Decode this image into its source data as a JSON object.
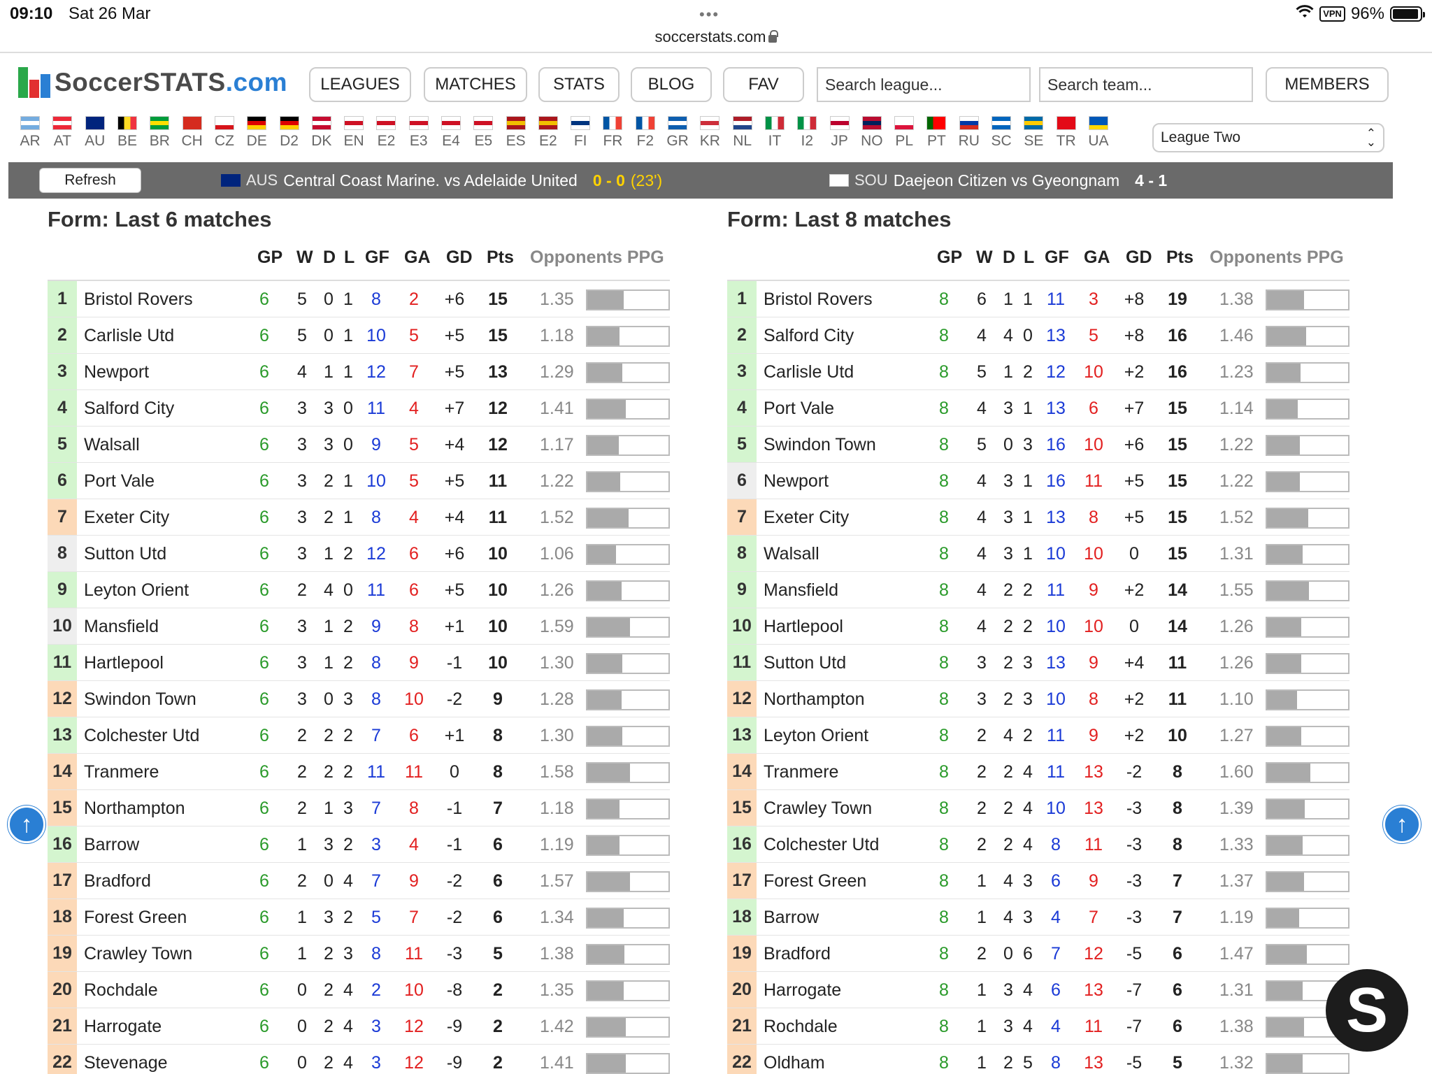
{
  "status": {
    "time": "09:10",
    "date": "Sat 26 Mar",
    "dots": "•••",
    "url": "soccerstats.com",
    "vpn": "VPN",
    "battery": "96%"
  },
  "logo": {
    "main": "SoccerSTATS",
    "suffix": ".com"
  },
  "nav": {
    "leagues": "LEAGUES",
    "matches": "MATCHES",
    "stats": "STATS",
    "blog": "BLOG",
    "fav": "FAV",
    "members": "MEMBERS",
    "search_league": "Search league...",
    "search_team": "Search team..."
  },
  "flags": [
    {
      "code": "AR",
      "colors": [
        "#74acdf",
        "#ffffff",
        "#74acdf"
      ]
    },
    {
      "code": "AT",
      "colors": [
        "#ed2939",
        "#ffffff",
        "#ed2939"
      ]
    },
    {
      "code": "AU",
      "colors": [
        "#00247d",
        "#00247d",
        "#00247d"
      ]
    },
    {
      "code": "BE",
      "colors": [
        "#000000",
        "#fdda24",
        "#ef3340"
      ],
      "vertical": true
    },
    {
      "code": "BR",
      "colors": [
        "#009c3b",
        "#ffdf00",
        "#009c3b"
      ]
    },
    {
      "code": "CH",
      "colors": [
        "#d52b1e",
        "#d52b1e",
        "#d52b1e"
      ]
    },
    {
      "code": "CZ",
      "colors": [
        "#ffffff",
        "#ffffff",
        "#d7141a"
      ]
    },
    {
      "code": "DE",
      "colors": [
        "#000000",
        "#dd0000",
        "#ffce00"
      ]
    },
    {
      "code": "D2",
      "colors": [
        "#000000",
        "#dd0000",
        "#ffce00"
      ]
    },
    {
      "code": "DK",
      "colors": [
        "#c60c30",
        "#ffffff",
        "#c60c30"
      ]
    },
    {
      "code": "EN",
      "colors": [
        "#ffffff",
        "#ce1124",
        "#ffffff"
      ]
    },
    {
      "code": "E2",
      "colors": [
        "#ffffff",
        "#ce1124",
        "#ffffff"
      ]
    },
    {
      "code": "E3",
      "colors": [
        "#ffffff",
        "#ce1124",
        "#ffffff"
      ]
    },
    {
      "code": "E4",
      "colors": [
        "#ffffff",
        "#ce1124",
        "#ffffff"
      ]
    },
    {
      "code": "E5",
      "colors": [
        "#ffffff",
        "#ce1124",
        "#ffffff"
      ]
    },
    {
      "code": "ES",
      "colors": [
        "#aa151b",
        "#f1bf00",
        "#aa151b"
      ]
    },
    {
      "code": "E2",
      "colors": [
        "#aa151b",
        "#f1bf00",
        "#aa151b"
      ]
    },
    {
      "code": "FI",
      "colors": [
        "#ffffff",
        "#003580",
        "#ffffff"
      ]
    },
    {
      "code": "FR",
      "colors": [
        "#0055a4",
        "#ffffff",
        "#ef4135"
      ],
      "vertical": true
    },
    {
      "code": "F2",
      "colors": [
        "#0055a4",
        "#ffffff",
        "#ef4135"
      ],
      "vertical": true
    },
    {
      "code": "GR",
      "colors": [
        "#0d5eaf",
        "#ffffff",
        "#0d5eaf"
      ]
    },
    {
      "code": "KR",
      "colors": [
        "#ffffff",
        "#cd2e3a",
        "#ffffff"
      ]
    },
    {
      "code": "NL",
      "colors": [
        "#ae1c28",
        "#ffffff",
        "#21468b"
      ]
    },
    {
      "code": "IT",
      "colors": [
        "#009246",
        "#ffffff",
        "#ce2b37"
      ],
      "vertical": true
    },
    {
      "code": "I2",
      "colors": [
        "#009246",
        "#ffffff",
        "#ce2b37"
      ],
      "vertical": true
    },
    {
      "code": "JP",
      "colors": [
        "#ffffff",
        "#bc002d",
        "#ffffff"
      ]
    },
    {
      "code": "NO",
      "colors": [
        "#ba0c2f",
        "#00205b",
        "#ba0c2f"
      ]
    },
    {
      "code": "PL",
      "colors": [
        "#ffffff",
        "#ffffff",
        "#dc143c"
      ]
    },
    {
      "code": "PT",
      "colors": [
        "#006600",
        "#ff0000",
        "#ff0000"
      ],
      "vertical": true
    },
    {
      "code": "RU",
      "colors": [
        "#ffffff",
        "#0039a6",
        "#d52b1e"
      ]
    },
    {
      "code": "SC",
      "colors": [
        "#0065bd",
        "#ffffff",
        "#0065bd"
      ]
    },
    {
      "code": "SE",
      "colors": [
        "#006aa7",
        "#fecc00",
        "#006aa7"
      ]
    },
    {
      "code": "TR",
      "colors": [
        "#e30a17",
        "#e30a17",
        "#e30a17"
      ]
    },
    {
      "code": "UA",
      "colors": [
        "#0057b7",
        "#0057b7",
        "#ffd700"
      ]
    }
  ],
  "league_select": "League Two",
  "ticker": {
    "refresh": "Refresh",
    "m1": {
      "cc": "AUS",
      "teams": "Central Coast Marine. vs Adelaide United",
      "score": "0 - 0",
      "minute": "(23')"
    },
    "m2": {
      "cc": "SOU",
      "teams": "Daejeon Citizen vs Gyeongnam",
      "score": "4 - 1"
    }
  },
  "colors": {
    "zone_green": "#d4f5cf",
    "zone_orange": "#fcd9b8",
    "zone_grey": "#eeeeee",
    "accent": "#2a7fd4"
  },
  "left": {
    "title": "Form: Last 6 matches",
    "headers": {
      "gp": "GP",
      "w": "W",
      "d": "D",
      "l": "L",
      "gf": "GF",
      "ga": "GA",
      "gd": "GD",
      "pts": "Pts",
      "ppg": "Opponents PPG"
    },
    "rows": [
      {
        "pos": "1",
        "team": "Bristol Rovers",
        "gp": "6",
        "w": "5",
        "d": "0",
        "l": "1",
        "gf": "8",
        "ga": "2",
        "gd": "+6",
        "pts": "15",
        "ppg": "1.35",
        "zone": "green"
      },
      {
        "pos": "2",
        "team": "Carlisle Utd",
        "gp": "6",
        "w": "5",
        "d": "0",
        "l": "1",
        "gf": "10",
        "ga": "5",
        "gd": "+5",
        "pts": "15",
        "ppg": "1.18",
        "zone": "green"
      },
      {
        "pos": "3",
        "team": "Newport",
        "gp": "6",
        "w": "4",
        "d": "1",
        "l": "1",
        "gf": "12",
        "ga": "7",
        "gd": "+5",
        "pts": "13",
        "ppg": "1.29",
        "zone": "green"
      },
      {
        "pos": "4",
        "team": "Salford City",
        "gp": "6",
        "w": "3",
        "d": "3",
        "l": "0",
        "gf": "11",
        "ga": "4",
        "gd": "+7",
        "pts": "12",
        "ppg": "1.41",
        "zone": "green"
      },
      {
        "pos": "5",
        "team": "Walsall",
        "gp": "6",
        "w": "3",
        "d": "3",
        "l": "0",
        "gf": "9",
        "ga": "5",
        "gd": "+4",
        "pts": "12",
        "ppg": "1.17",
        "zone": "green"
      },
      {
        "pos": "6",
        "team": "Port Vale",
        "gp": "6",
        "w": "3",
        "d": "2",
        "l": "1",
        "gf": "10",
        "ga": "5",
        "gd": "+5",
        "pts": "11",
        "ppg": "1.22",
        "zone": "green"
      },
      {
        "pos": "7",
        "team": "Exeter City",
        "gp": "6",
        "w": "3",
        "d": "2",
        "l": "1",
        "gf": "8",
        "ga": "4",
        "gd": "+4",
        "pts": "11",
        "ppg": "1.52",
        "zone": "orange"
      },
      {
        "pos": "8",
        "team": "Sutton Utd",
        "gp": "6",
        "w": "3",
        "d": "1",
        "l": "2",
        "gf": "12",
        "ga": "6",
        "gd": "+6",
        "pts": "10",
        "ppg": "1.06",
        "zone": "grey"
      },
      {
        "pos": "9",
        "team": "Leyton Orient",
        "gp": "6",
        "w": "2",
        "d": "4",
        "l": "0",
        "gf": "11",
        "ga": "6",
        "gd": "+5",
        "pts": "10",
        "ppg": "1.26",
        "zone": "green"
      },
      {
        "pos": "10",
        "team": "Mansfield",
        "gp": "6",
        "w": "3",
        "d": "1",
        "l": "2",
        "gf": "9",
        "ga": "8",
        "gd": "+1",
        "pts": "10",
        "ppg": "1.59",
        "zone": "grey"
      },
      {
        "pos": "11",
        "team": "Hartlepool",
        "gp": "6",
        "w": "3",
        "d": "1",
        "l": "2",
        "gf": "8",
        "ga": "9",
        "gd": "-1",
        "pts": "10",
        "ppg": "1.30",
        "zone": "green"
      },
      {
        "pos": "12",
        "team": "Swindon Town",
        "gp": "6",
        "w": "3",
        "d": "0",
        "l": "3",
        "gf": "8",
        "ga": "10",
        "gd": "-2",
        "pts": "9",
        "ppg": "1.28",
        "zone": "orange"
      },
      {
        "pos": "13",
        "team": "Colchester Utd",
        "gp": "6",
        "w": "2",
        "d": "2",
        "l": "2",
        "gf": "7",
        "ga": "6",
        "gd": "+1",
        "pts": "8",
        "ppg": "1.30",
        "zone": "green"
      },
      {
        "pos": "14",
        "team": "Tranmere",
        "gp": "6",
        "w": "2",
        "d": "2",
        "l": "2",
        "gf": "11",
        "ga": "11",
        "gd": "0",
        "pts": "8",
        "ppg": "1.58",
        "zone": "orange"
      },
      {
        "pos": "15",
        "team": "Northampton",
        "gp": "6",
        "w": "2",
        "d": "1",
        "l": "3",
        "gf": "7",
        "ga": "8",
        "gd": "-1",
        "pts": "7",
        "ppg": "1.18",
        "zone": "orange"
      },
      {
        "pos": "16",
        "team": "Barrow",
        "gp": "6",
        "w": "1",
        "d": "3",
        "l": "2",
        "gf": "3",
        "ga": "4",
        "gd": "-1",
        "pts": "6",
        "ppg": "1.19",
        "zone": "green"
      },
      {
        "pos": "17",
        "team": "Bradford",
        "gp": "6",
        "w": "2",
        "d": "0",
        "l": "4",
        "gf": "7",
        "ga": "9",
        "gd": "-2",
        "pts": "6",
        "ppg": "1.57",
        "zone": "orange"
      },
      {
        "pos": "18",
        "team": "Forest Green",
        "gp": "6",
        "w": "1",
        "d": "3",
        "l": "2",
        "gf": "5",
        "ga": "7",
        "gd": "-2",
        "pts": "6",
        "ppg": "1.34",
        "zone": "orange"
      },
      {
        "pos": "19",
        "team": "Crawley Town",
        "gp": "6",
        "w": "1",
        "d": "2",
        "l": "3",
        "gf": "8",
        "ga": "11",
        "gd": "-3",
        "pts": "5",
        "ppg": "1.38",
        "zone": "orange"
      },
      {
        "pos": "20",
        "team": "Rochdale",
        "gp": "6",
        "w": "0",
        "d": "2",
        "l": "4",
        "gf": "2",
        "ga": "10",
        "gd": "-8",
        "pts": "2",
        "ppg": "1.35",
        "zone": "orange"
      },
      {
        "pos": "21",
        "team": "Harrogate",
        "gp": "6",
        "w": "0",
        "d": "2",
        "l": "4",
        "gf": "3",
        "ga": "12",
        "gd": "-9",
        "pts": "2",
        "ppg": "1.42",
        "zone": "orange"
      },
      {
        "pos": "22",
        "team": "Stevenage",
        "gp": "6",
        "w": "0",
        "d": "2",
        "l": "4",
        "gf": "3",
        "ga": "12",
        "gd": "-9",
        "pts": "2",
        "ppg": "1.41",
        "zone": "orange"
      }
    ]
  },
  "right": {
    "title": "Form: Last 8 matches",
    "headers": {
      "gp": "GP",
      "w": "W",
      "d": "D",
      "l": "L",
      "gf": "GF",
      "ga": "GA",
      "gd": "GD",
      "pts": "Pts",
      "ppg": "Opponents PPG"
    },
    "rows": [
      {
        "pos": "1",
        "team": "Bristol Rovers",
        "gp": "8",
        "w": "6",
        "d": "1",
        "l": "1",
        "gf": "11",
        "ga": "3",
        "gd": "+8",
        "pts": "19",
        "ppg": "1.38",
        "zone": "green"
      },
      {
        "pos": "2",
        "team": "Salford City",
        "gp": "8",
        "w": "4",
        "d": "4",
        "l": "0",
        "gf": "13",
        "ga": "5",
        "gd": "+8",
        "pts": "16",
        "ppg": "1.46",
        "zone": "green"
      },
      {
        "pos": "3",
        "team": "Carlisle Utd",
        "gp": "8",
        "w": "5",
        "d": "1",
        "l": "2",
        "gf": "12",
        "ga": "10",
        "gd": "+2",
        "pts": "16",
        "ppg": "1.23",
        "zone": "green"
      },
      {
        "pos": "4",
        "team": "Port Vale",
        "gp": "8",
        "w": "4",
        "d": "3",
        "l": "1",
        "gf": "13",
        "ga": "6",
        "gd": "+7",
        "pts": "15",
        "ppg": "1.14",
        "zone": "green"
      },
      {
        "pos": "5",
        "team": "Swindon Town",
        "gp": "8",
        "w": "5",
        "d": "0",
        "l": "3",
        "gf": "16",
        "ga": "10",
        "gd": "+6",
        "pts": "15",
        "ppg": "1.22",
        "zone": "green"
      },
      {
        "pos": "6",
        "team": "Newport",
        "gp": "8",
        "w": "4",
        "d": "3",
        "l": "1",
        "gf": "16",
        "ga": "11",
        "gd": "+5",
        "pts": "15",
        "ppg": "1.22",
        "zone": "grey"
      },
      {
        "pos": "7",
        "team": "Exeter City",
        "gp": "8",
        "w": "4",
        "d": "3",
        "l": "1",
        "gf": "13",
        "ga": "8",
        "gd": "+5",
        "pts": "15",
        "ppg": "1.52",
        "zone": "orange"
      },
      {
        "pos": "8",
        "team": "Walsall",
        "gp": "8",
        "w": "4",
        "d": "3",
        "l": "1",
        "gf": "10",
        "ga": "10",
        "gd": "0",
        "pts": "15",
        "ppg": "1.31",
        "zone": "green"
      },
      {
        "pos": "9",
        "team": "Mansfield",
        "gp": "8",
        "w": "4",
        "d": "2",
        "l": "2",
        "gf": "11",
        "ga": "9",
        "gd": "+2",
        "pts": "14",
        "ppg": "1.55",
        "zone": "green"
      },
      {
        "pos": "10",
        "team": "Hartlepool",
        "gp": "8",
        "w": "4",
        "d": "2",
        "l": "2",
        "gf": "10",
        "ga": "10",
        "gd": "0",
        "pts": "14",
        "ppg": "1.26",
        "zone": "green"
      },
      {
        "pos": "11",
        "team": "Sutton Utd",
        "gp": "8",
        "w": "3",
        "d": "2",
        "l": "3",
        "gf": "13",
        "ga": "9",
        "gd": "+4",
        "pts": "11",
        "ppg": "1.26",
        "zone": "green"
      },
      {
        "pos": "12",
        "team": "Northampton",
        "gp": "8",
        "w": "3",
        "d": "2",
        "l": "3",
        "gf": "10",
        "ga": "8",
        "gd": "+2",
        "pts": "11",
        "ppg": "1.10",
        "zone": "orange"
      },
      {
        "pos": "13",
        "team": "Leyton Orient",
        "gp": "8",
        "w": "2",
        "d": "4",
        "l": "2",
        "gf": "11",
        "ga": "9",
        "gd": "+2",
        "pts": "10",
        "ppg": "1.27",
        "zone": "green"
      },
      {
        "pos": "14",
        "team": "Tranmere",
        "gp": "8",
        "w": "2",
        "d": "2",
        "l": "4",
        "gf": "11",
        "ga": "13",
        "gd": "-2",
        "pts": "8",
        "ppg": "1.60",
        "zone": "orange"
      },
      {
        "pos": "15",
        "team": "Crawley Town",
        "gp": "8",
        "w": "2",
        "d": "2",
        "l": "4",
        "gf": "10",
        "ga": "13",
        "gd": "-3",
        "pts": "8",
        "ppg": "1.39",
        "zone": "orange"
      },
      {
        "pos": "16",
        "team": "Colchester Utd",
        "gp": "8",
        "w": "2",
        "d": "2",
        "l": "4",
        "gf": "8",
        "ga": "11",
        "gd": "-3",
        "pts": "8",
        "ppg": "1.33",
        "zone": "green"
      },
      {
        "pos": "17",
        "team": "Forest Green",
        "gp": "8",
        "w": "1",
        "d": "4",
        "l": "3",
        "gf": "6",
        "ga": "9",
        "gd": "-3",
        "pts": "7",
        "ppg": "1.37",
        "zone": "orange"
      },
      {
        "pos": "18",
        "team": "Barrow",
        "gp": "8",
        "w": "1",
        "d": "4",
        "l": "3",
        "gf": "4",
        "ga": "7",
        "gd": "-3",
        "pts": "7",
        "ppg": "1.19",
        "zone": "green"
      },
      {
        "pos": "19",
        "team": "Bradford",
        "gp": "8",
        "w": "2",
        "d": "0",
        "l": "6",
        "gf": "7",
        "ga": "12",
        "gd": "-5",
        "pts": "6",
        "ppg": "1.47",
        "zone": "orange"
      },
      {
        "pos": "20",
        "team": "Harrogate",
        "gp": "8",
        "w": "1",
        "d": "3",
        "l": "4",
        "gf": "6",
        "ga": "13",
        "gd": "-7",
        "pts": "6",
        "ppg": "1.31",
        "zone": "orange"
      },
      {
        "pos": "21",
        "team": "Rochdale",
        "gp": "8",
        "w": "1",
        "d": "3",
        "l": "4",
        "gf": "4",
        "ga": "11",
        "gd": "-7",
        "pts": "6",
        "ppg": "1.38",
        "zone": "orange"
      },
      {
        "pos": "22",
        "team": "Oldham",
        "gp": "8",
        "w": "1",
        "d": "2",
        "l": "5",
        "gf": "8",
        "ga": "13",
        "gd": "-5",
        "pts": "5",
        "ppg": "1.32",
        "zone": "orange"
      }
    ]
  },
  "floating": {
    "up_arrow": "↑",
    "bubble": "S"
  }
}
